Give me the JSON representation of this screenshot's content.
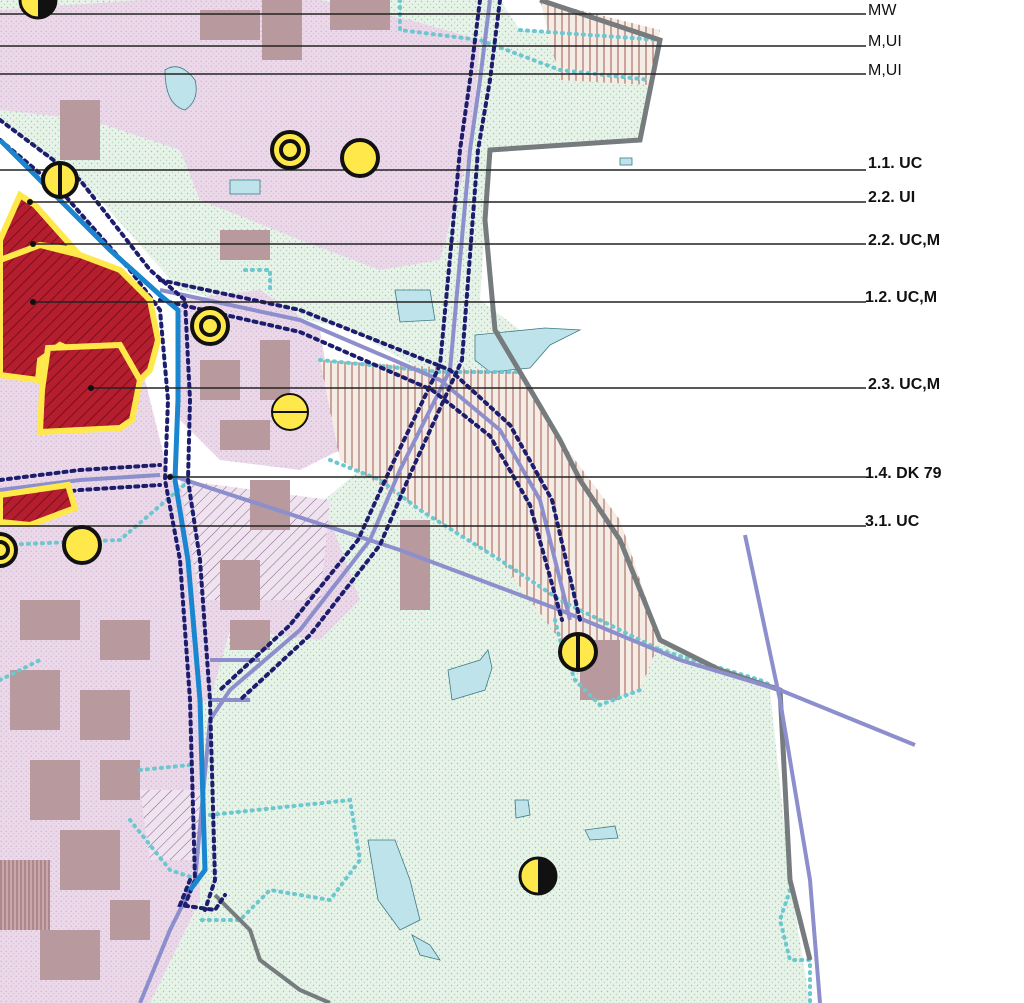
{
  "map": {
    "labels": [
      {
        "id": "mw",
        "text": "MW",
        "bold": false
      },
      {
        "id": "mui-1",
        "text": "M,UI",
        "bold": false
      },
      {
        "id": "mui-2",
        "text": "M,UI",
        "bold": false
      },
      {
        "id": "l-1-1",
        "text": "1.1. UC",
        "bold": true
      },
      {
        "id": "l-2-2-ui",
        "text": "2.2. UI",
        "bold": true
      },
      {
        "id": "l-2-2-ucm",
        "text": "2.2. UC,M",
        "bold": true
      },
      {
        "id": "l-1-2",
        "text": "1.2. UC,M",
        "bold": true
      },
      {
        "id": "l-2-3",
        "text": "2.3. UC,M",
        "bold": true
      },
      {
        "id": "l-1-4",
        "text": "1.4. DK 79",
        "bold": true
      },
      {
        "id": "l-3-1",
        "text": "3.1. UC",
        "bold": true
      }
    ],
    "colors": {
      "green_area": "#e7f2e8",
      "residential": "#e8d5e8",
      "buildings": "#b89a9e",
      "water": "#bfe3ea",
      "central_red": "#b41e2e",
      "yellow": "#ffe84a",
      "dark_blue": "#1c1d6e",
      "bright_blue": "#1a86d0",
      "lavender": "#8c8fcc",
      "cyan_dotted": "#6cc7cf",
      "border_grey": "#767b7e",
      "hatch_brown": "#9b5b4e"
    },
    "symbols": [
      {
        "id": "sym-ring-a",
        "kind": "ring-icon"
      },
      {
        "id": "sym-circle-a",
        "kind": "filled-circle-icon"
      },
      {
        "id": "sym-halfv-a",
        "kind": "vertical-bar-circle-icon"
      },
      {
        "id": "sym-ring-b",
        "kind": "ring-icon"
      },
      {
        "id": "sym-halfh-a",
        "kind": "horizontal-bar-circle-icon"
      },
      {
        "id": "sym-circle-b",
        "kind": "filled-circle-icon"
      },
      {
        "id": "sym-halfv-b",
        "kind": "vertical-bar-circle-icon"
      },
      {
        "id": "sym-half-dark",
        "kind": "half-dark-circle-icon"
      }
    ]
  }
}
